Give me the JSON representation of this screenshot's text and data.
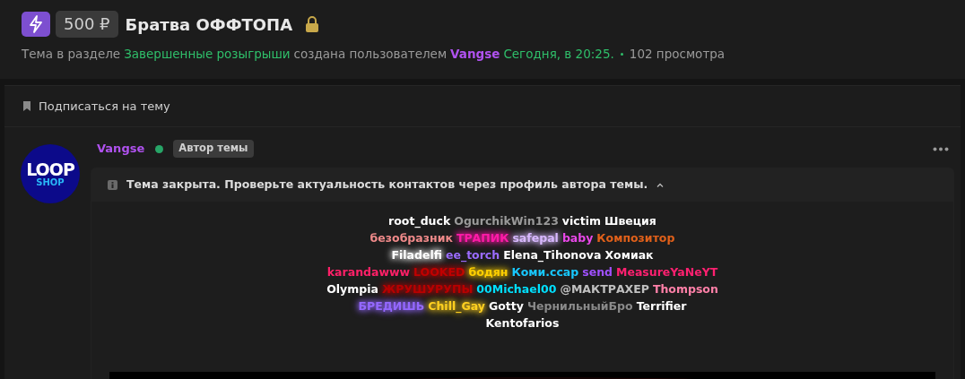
{
  "thread": {
    "price": "500 ₽",
    "title": "Братва ОФФТОПА",
    "locked": true,
    "meta": {
      "prefix": "Тема в разделе",
      "section": "Завершенные розыгрыши",
      "created_by": "создана пользователем",
      "author": "Vangse",
      "date": "Сегодня, в 20:25.",
      "views": "102 просмотра"
    }
  },
  "subscribe": "Подписаться на тему",
  "post": {
    "avatar": {
      "line_1": "LOOP",
      "line_2": "SHOP"
    },
    "author": "Vangse",
    "online": true,
    "badge": "Автор темы",
    "notice": "Тема закрыта. Проверьте актуальность контактов через профиль автора темы.",
    "expanded": true,
    "lines": [
      [
        {
          "text": "root_duck",
          "color": "#ffffff",
          "glow": false
        },
        {
          "text": "OgurchikWin123",
          "color": "#9a9a9a",
          "glow": false
        },
        {
          "text": "victim",
          "color": "#ffffff",
          "glow": false
        },
        {
          "text": "Швеция",
          "color": "#ffffff",
          "glow": false
        }
      ],
      [
        {
          "text": "безобразник",
          "color": "#f08a8a",
          "glow": false
        },
        {
          "text": "ТРАПИК",
          "color": "#ff1aa8",
          "glow": true
        },
        {
          "text": "safepal",
          "color": "#d8b8ff",
          "glow": true
        },
        {
          "text": "baby",
          "color": "#e848e8",
          "glow": false
        },
        {
          "text": "Композитор",
          "color": "#e0601a",
          "glow": false
        }
      ],
      [
        {
          "text": "Filadelfi",
          "color": "#ffffff",
          "glow": true
        },
        {
          "text": "ee_torch",
          "color": "#9b6cff",
          "glow": false
        },
        {
          "text": "Elena_Tihonova",
          "color": "#ffffff",
          "glow": false
        },
        {
          "text": "Хомиак",
          "color": "#ffffff",
          "glow": false
        }
      ],
      [
        {
          "text": "karandawww",
          "color": "#ff2068",
          "glow": false
        },
        {
          "text": "LOOKED",
          "color": "#c00000",
          "glow": true
        },
        {
          "text": "бодян",
          "color": "#ffd000",
          "glow": true
        },
        {
          "text": "Коми.ccap",
          "color": "#18c8ff",
          "glow": false
        },
        {
          "text": "send",
          "color": "#a050ff",
          "glow": false
        },
        {
          "text": "MeasureYaNeYT",
          "color": "#ff2070",
          "glow": false
        }
      ],
      [
        {
          "text": "Olympia",
          "color": "#ffffff",
          "glow": false
        },
        {
          "text": "ЖРУШУРУПЫ",
          "color": "#b80000",
          "glow": true
        },
        {
          "text": "00Michael00",
          "color": "#00e0ff",
          "glow": false
        },
        {
          "text": "@МАКТРАХЕР",
          "color": "#c0c0c0",
          "glow": false
        },
        {
          "text": "Thompson",
          "color": "#ff80a8",
          "glow": false
        }
      ],
      [
        {
          "text": "БРЕДИШЬ",
          "color": "#9468ff",
          "glow": true
        },
        {
          "text": "Chill_Gay",
          "color": "#ffd020",
          "glow": true
        },
        {
          "text": "Gotty",
          "color": "#ffffff",
          "glow": false
        },
        {
          "text": "ЧернильныйБро",
          "color": "#8a8a8a",
          "glow": false
        },
        {
          "text": "Terrifier",
          "color": "#ffffff",
          "glow": false
        }
      ],
      [
        {
          "text": "Kentofarios",
          "color": "#ffffff",
          "glow": false
        }
      ]
    ]
  }
}
